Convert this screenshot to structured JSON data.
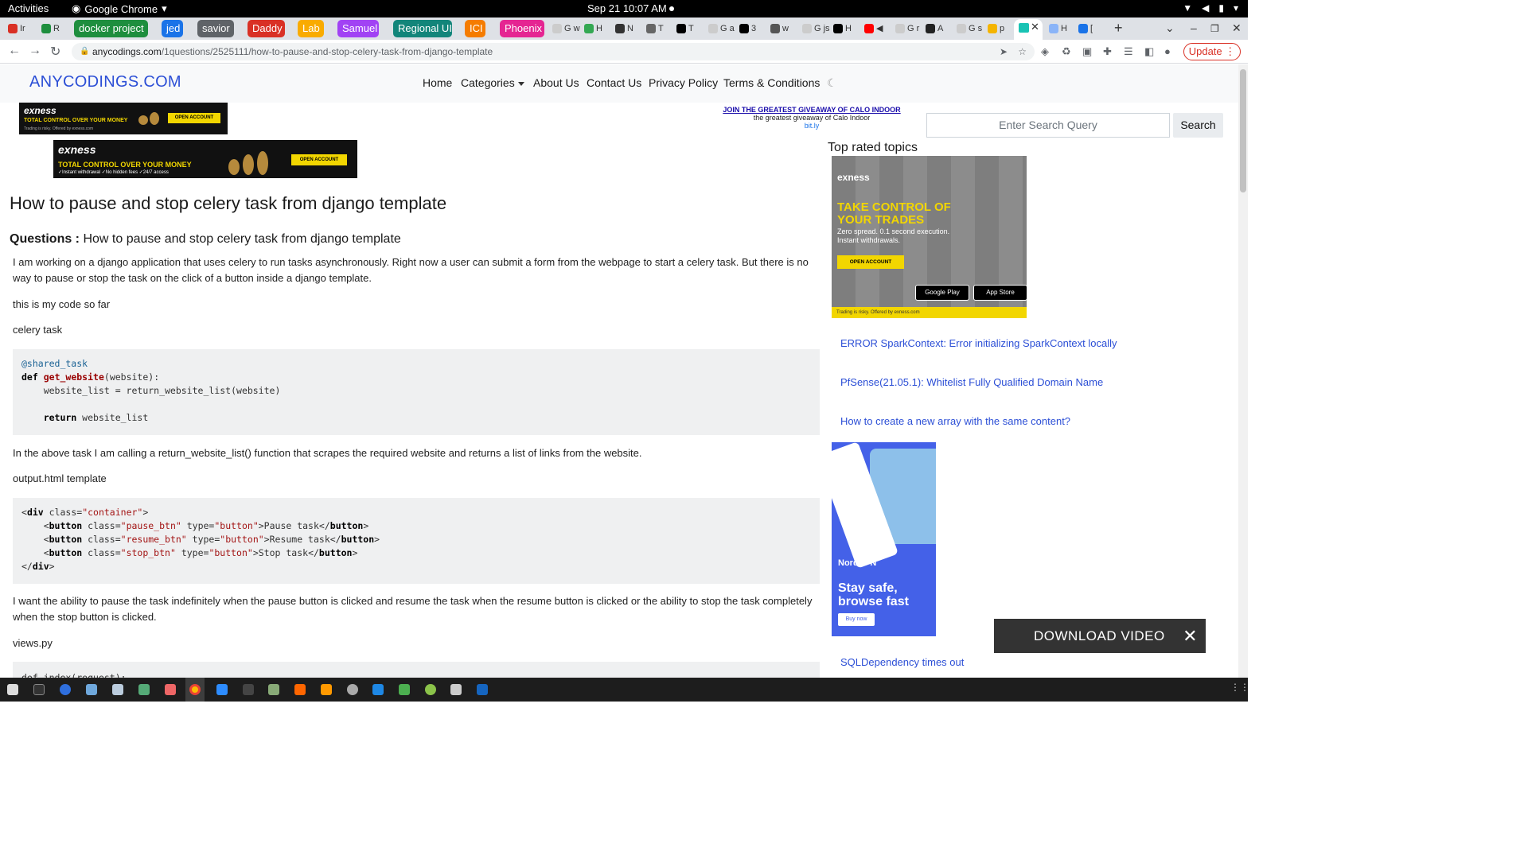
{
  "topbar": {
    "activities": "Activities",
    "app": "Google Chrome",
    "clock": "Sep 21  10:07 AM"
  },
  "tabs": [
    {
      "label": "docker project",
      "color": "#1e8e3e"
    },
    {
      "label": "jed",
      "color": "#1a73e8"
    },
    {
      "label": "savior",
      "color": "#5f6368"
    },
    {
      "label": "Daddy",
      "color": "#d93025"
    },
    {
      "label": "Lab",
      "color": "#f9ab00"
    },
    {
      "label": "Samuel",
      "color": "#a142f4"
    },
    {
      "label": "Regional UI",
      "color": "#12857a"
    },
    {
      "label": "ICI",
      "color": "#f57c00"
    },
    {
      "label": "Phoenix",
      "color": "#e52592"
    }
  ],
  "mini_tabs": [
    "Ir",
    "R",
    "G w",
    "H",
    "N",
    "T",
    "T",
    "G a",
    "3",
    "w",
    "G js",
    "H",
    "G r",
    "A",
    "G s",
    "p",
    "H",
    "["
  ],
  "address": {
    "host": "anycodings.com",
    "path": "/1questions/2525111/how-to-pause-and-stop-celery-task-from-django-template"
  },
  "update_button": "Update",
  "site": {
    "logo": "ANYCODINGS.COM",
    "nav": [
      "Home",
      "Categories",
      "About Us",
      "Contact Us",
      "Privacy Policy",
      "Terms & Conditions"
    ]
  },
  "ads": {
    "exness_brand": "exness",
    "exness_line": "TOTAL CONTROL OVER YOUR MONEY",
    "exness_sub": "Trading is risky. Offered by exness.com",
    "exness_sub2": "✓Instant withdrawal ✓No hidden fees ✓24/7 access",
    "exness_cta": "OPEN ACCOUNT",
    "promo_l1": "JOIN THE GREATEST GIVEAWAY OF CALO INDOOR",
    "promo_l2": "the greatest giveaway of Calo Indoor",
    "promo_l3": "bit.ly",
    "big_t1": "TAKE CONTROL OF YOUR TRADES",
    "big_t2": "Zero spread. 0.1 second execution. Instant withdrawals.",
    "big_google": "Google Play",
    "big_apple": "App Store",
    "big_risk": "Trading is risky. Offered by exness.com",
    "nord_logo": "NordVPN",
    "nord_stay": "Stay safe, browse fast",
    "nord_buy": "Buy now"
  },
  "search": {
    "placeholder": "Enter Search Query",
    "button": "Search"
  },
  "article": {
    "title": "How to pause and stop celery task from django template",
    "q_label": "Questions :",
    "q_title": "How to pause and stop celery task from django template",
    "p1": "I am working on a django application that uses celery to run tasks asynchronously. Right now a user can submit a form from the webpage to start a celery task. But there is no way to pause or stop the task on the click of a button inside a django template.",
    "p2": "this is my code so far",
    "p3": "celery task",
    "p4": "In the above task I am calling a return_website_list() function that scrapes the required website and returns a list of links from the website.",
    "p5": "output.html template",
    "p6": "I want the ability to pause the task indefinitely when the pause button is clicked and resume the task when the resume button is clicked or the ability to stop the task completely when the stop button is clicked.",
    "p7": "views.py",
    "code3_line": "def index(request):"
  },
  "sidebar": {
    "heading": "Top rated topics",
    "links": [
      "ERROR SparkContext: Error initializing SparkContext locally",
      "PfSense(21.05.1): Whitelist Fully Qualified Domain Name",
      "How to create a new array with the same content?",
      "SQLDependency times out"
    ]
  },
  "download": "DOWNLOAD VIDEO"
}
